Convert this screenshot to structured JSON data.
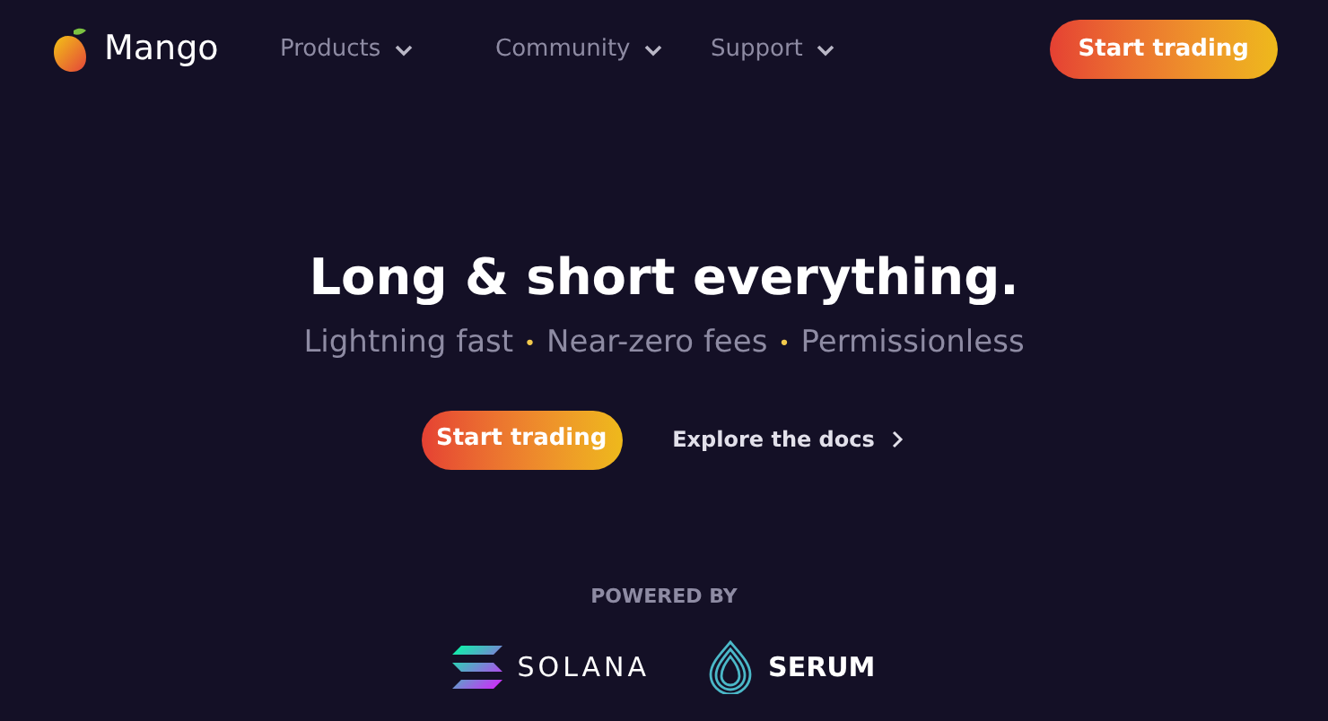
{
  "brand": {
    "name": "Mango"
  },
  "nav": [
    {
      "label": "Products"
    },
    {
      "label": "Community"
    },
    {
      "label": "Support"
    }
  ],
  "nav_cta": "Start trading",
  "hero": {
    "title": "Long & short everything.",
    "features": [
      "Lightning fast",
      "Near-zero fees",
      "Permissionless"
    ],
    "separator": "•",
    "primary_button": "Start trading",
    "secondary_link": "Explore the docs"
  },
  "powered_by": {
    "label": "POWERED BY",
    "partners": [
      {
        "name": "SOLANA",
        "kind": "solana"
      },
      {
        "name": "SERUM",
        "kind": "serum"
      }
    ]
  }
}
